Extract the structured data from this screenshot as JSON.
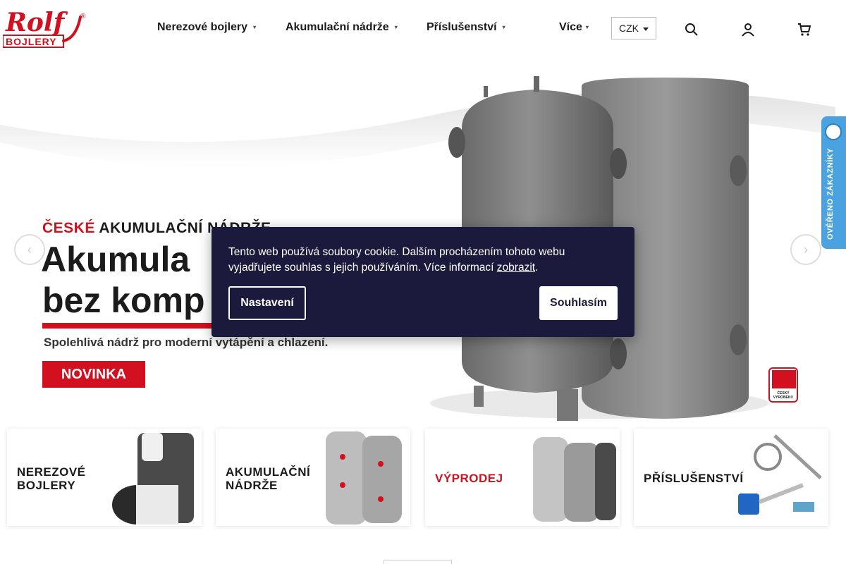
{
  "brand": {
    "name": "Rolf BOJLERY",
    "logo_text": "Rolf",
    "logo_sub": "BOJLERY",
    "logo_mark": "®",
    "accent": "#d3101f"
  },
  "nav": {
    "items": [
      {
        "label": "Nerezové bojlery",
        "icon": "chevron-down-icon"
      },
      {
        "label": "Akumulační nádrže",
        "icon": "chevron-down-icon"
      },
      {
        "label": "Příslušenství",
        "icon": "chevron-down-icon"
      },
      {
        "label": "Více",
        "icon": "chevron-down-icon"
      }
    ],
    "currency": "CZK",
    "icons": [
      "search-icon",
      "user-icon",
      "cart-icon"
    ]
  },
  "hero": {
    "brand_red": "ČESKÉ",
    "brand_rest": " AKUMULAČNÍ NÁDRŽE",
    "heading_line1": "Akumula",
    "heading_line2": "bez komp",
    "subtitle": "Spolehlivá nádrž pro moderní vytápění a chlazení.",
    "badge": "NOVINKA",
    "czech_label": "ČESKÝ VÝROBEK®",
    "arrow_prev": "‹",
    "arrow_next": "›"
  },
  "side_badge": {
    "label": "OVĚŘENO ZÁKAZNÍKY",
    "color": "#4aa3e0"
  },
  "categories": [
    {
      "line1": "NEREZOVÉ",
      "line2": "BOJLERY"
    },
    {
      "line1": "AKUMULAČNÍ",
      "line2": "NÁDRŽE"
    },
    {
      "line1": "VÝPRODEJ",
      "line2": ""
    },
    {
      "line1": "PŘÍSLUŠENSTVÍ",
      "line2": ""
    }
  ],
  "cookie": {
    "text": "Tento web používá soubory cookie. Dalším procházením tohoto webu vyjadřujete souhlas s jejich používáním. Více informací ",
    "link": "zobrazit",
    "after": ".",
    "settings_label": "Nastavení",
    "agree_label": "Souhlasím",
    "background": "#1c1a3c"
  }
}
